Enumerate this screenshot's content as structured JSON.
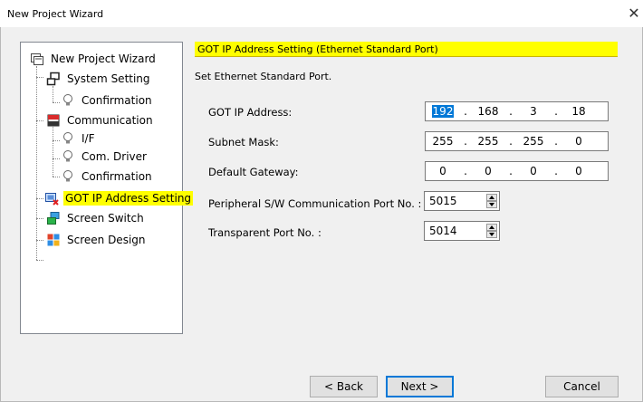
{
  "window": {
    "title": "New Project Wizard",
    "close_glyph": "✕"
  },
  "tree": {
    "items": [
      {
        "label": "New Project Wizard",
        "icon": "wizard-icon"
      },
      {
        "label": "System Setting",
        "icon": "system-setting-icon"
      },
      {
        "label": "Confirmation",
        "icon": "lightbulb-icon"
      },
      {
        "label": "Communication",
        "icon": "communication-icon"
      },
      {
        "label": "I/F",
        "icon": "lightbulb-icon"
      },
      {
        "label": "Com. Driver",
        "icon": "lightbulb-icon"
      },
      {
        "label": "Confirmation",
        "icon": "lightbulb-icon"
      },
      {
        "label": "GOT IP Address Setting",
        "icon": "got-ip-icon",
        "selected": true
      },
      {
        "label": "Screen Switch",
        "icon": "screen-switch-icon"
      },
      {
        "label": "Screen Design",
        "icon": "screen-design-icon"
      }
    ]
  },
  "main": {
    "heading": "GOT IP Address Setting (Ethernet Standard Port)",
    "subtitle": "Set Ethernet Standard Port.",
    "got_ip": {
      "label": "GOT IP Address:",
      "octets": [
        "192",
        "168",
        "3",
        "18"
      ]
    },
    "subnet": {
      "label": "Subnet Mask:",
      "octets": [
        "255",
        "255",
        "255",
        "0"
      ]
    },
    "gateway": {
      "label": "Default Gateway:",
      "octets": [
        "0",
        "0",
        "0",
        "0"
      ]
    },
    "peripheral": {
      "label": "Peripheral S/W Communication Port No. :",
      "value": "5015"
    },
    "transparent": {
      "label": "Transparent Port No. :",
      "value": "5014"
    }
  },
  "buttons": {
    "back": "< Back",
    "next": "Next >",
    "cancel": "Cancel"
  },
  "colors": {
    "highlight": "#ffff00",
    "selection": "#0078d7"
  }
}
